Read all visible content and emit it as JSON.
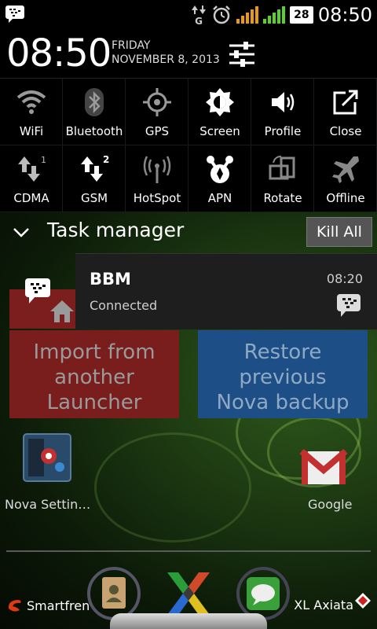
{
  "status_bar": {
    "time": "08:50",
    "battery": "28",
    "network_letter": "G"
  },
  "header": {
    "time": "08:50",
    "day": "FRIDAY",
    "date": "NOVEMBER 8, 2013"
  },
  "toggles": [
    {
      "label": "WiFi",
      "icon": "wifi-icon"
    },
    {
      "label": "Bluetooth",
      "icon": "bluetooth-icon"
    },
    {
      "label": "GPS",
      "icon": "gps-icon"
    },
    {
      "label": "Screen",
      "icon": "brightness-icon"
    },
    {
      "label": "Profile",
      "icon": "speaker-icon"
    },
    {
      "label": "Close",
      "icon": "close-panel-icon"
    },
    {
      "label": "CDMA",
      "icon": "cdma-data-icon"
    },
    {
      "label": "GSM",
      "icon": "gsm-data-icon"
    },
    {
      "label": "HotSpot",
      "icon": "hotspot-icon"
    },
    {
      "label": "APN",
      "icon": "apn-icon"
    },
    {
      "label": "Rotate",
      "icon": "rotate-icon"
    },
    {
      "label": "Offline",
      "icon": "airplane-icon"
    }
  ],
  "task_manager": {
    "title": "Task manager",
    "kill_all": "Kill All"
  },
  "notification": {
    "title": "BBM",
    "subtitle": "Connected",
    "time": "08:20"
  },
  "launcher": {
    "import_line1": "Import from",
    "import_line2": "another Launcher",
    "restore_line1": "Restore previous",
    "restore_line2": "Nova backup",
    "nova_label": "Nova Settin…",
    "google_label": "Google"
  },
  "carriers": {
    "left": "Smartfren",
    "right": "XL Axiata"
  },
  "colors": {
    "import_tile": "#7a1d1d",
    "restore_tile": "#1d4f86",
    "signal_green": "#5ad02a",
    "signal_orange": "#e89a10"
  }
}
